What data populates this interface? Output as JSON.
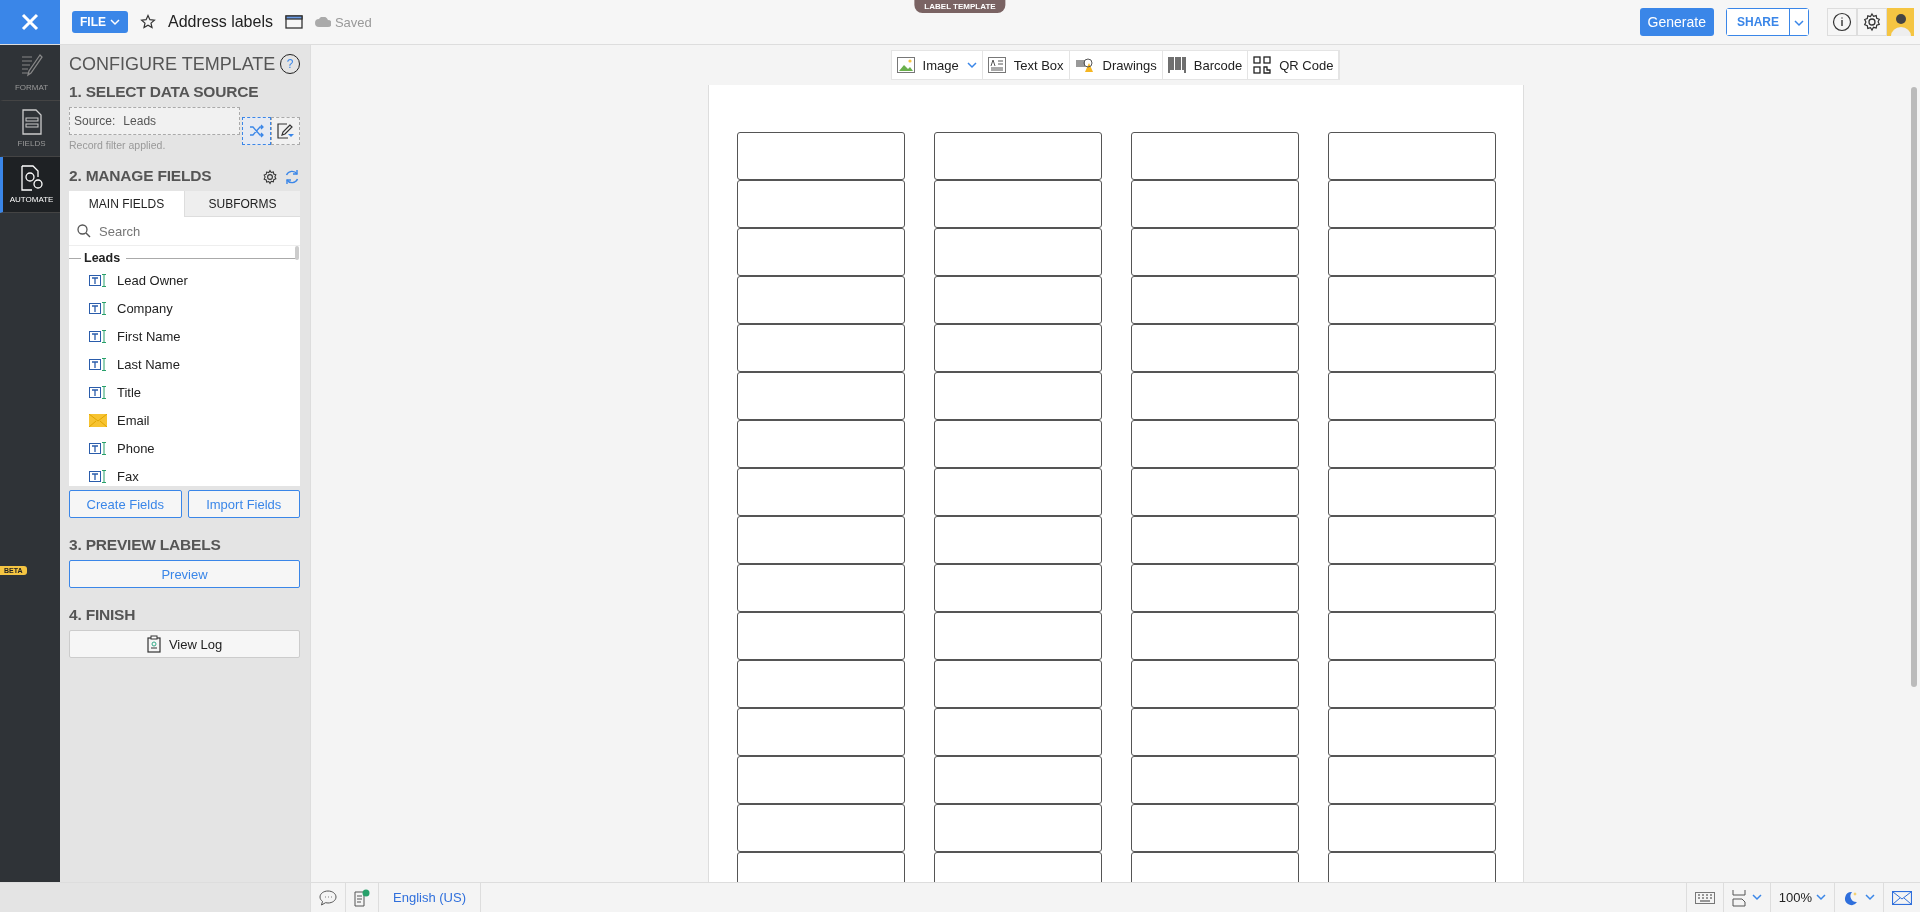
{
  "header": {
    "file_menu": "FILE",
    "document_title": "Address labels",
    "save_status": "Saved",
    "mode_tag": "LABEL TEMPLATE",
    "generate": "Generate",
    "share": "SHARE"
  },
  "rail": {
    "items": [
      {
        "label": "FORMAT",
        "kind": "format",
        "selected": false
      },
      {
        "label": "FIELDS",
        "kind": "fields",
        "selected": false
      },
      {
        "label": "AUTOMATE",
        "kind": "automate",
        "selected": true
      }
    ],
    "badge": "BETA"
  },
  "panel": {
    "title": "CONFIGURE TEMPLATE",
    "help": "?",
    "step1": {
      "heading": "1. SELECT DATA SOURCE",
      "source_label": "Source:",
      "source_value": "Leads",
      "note": "Record filter applied."
    },
    "step2": {
      "heading": "2. MANAGE FIELDS",
      "tabs": [
        {
          "label": "MAIN FIELDS",
          "selected": true
        },
        {
          "label": "SUBFORMS",
          "selected": false
        }
      ],
      "search": {
        "placeholder": "Search"
      },
      "group": "Leads",
      "fields": [
        {
          "name": "Lead Owner",
          "kind": "text"
        },
        {
          "name": "Company",
          "kind": "text"
        },
        {
          "name": "First Name",
          "kind": "text"
        },
        {
          "name": "Last Name",
          "kind": "text"
        },
        {
          "name": "Title",
          "kind": "text"
        },
        {
          "name": "Email",
          "kind": "email"
        },
        {
          "name": "Phone",
          "kind": "text"
        },
        {
          "name": "Fax",
          "kind": "text"
        }
      ],
      "buttons": [
        "Create Fields",
        "Import Fields"
      ]
    },
    "step3": {
      "heading": "3. PREVIEW LABELS",
      "button": "Preview"
    },
    "step4": {
      "heading": "4. FINISH",
      "button": "View Log"
    }
  },
  "toolbar": [
    {
      "label": "Image",
      "kind": "image"
    },
    {
      "label": "Text Box",
      "kind": "textbox"
    },
    {
      "label": "Drawings",
      "kind": "drawings"
    },
    {
      "label": "Barcode",
      "kind": "barcode"
    },
    {
      "label": "QR Code",
      "kind": "qrcode"
    }
  ],
  "status_bar": {
    "language": "English (US)",
    "zoom": "100%"
  }
}
